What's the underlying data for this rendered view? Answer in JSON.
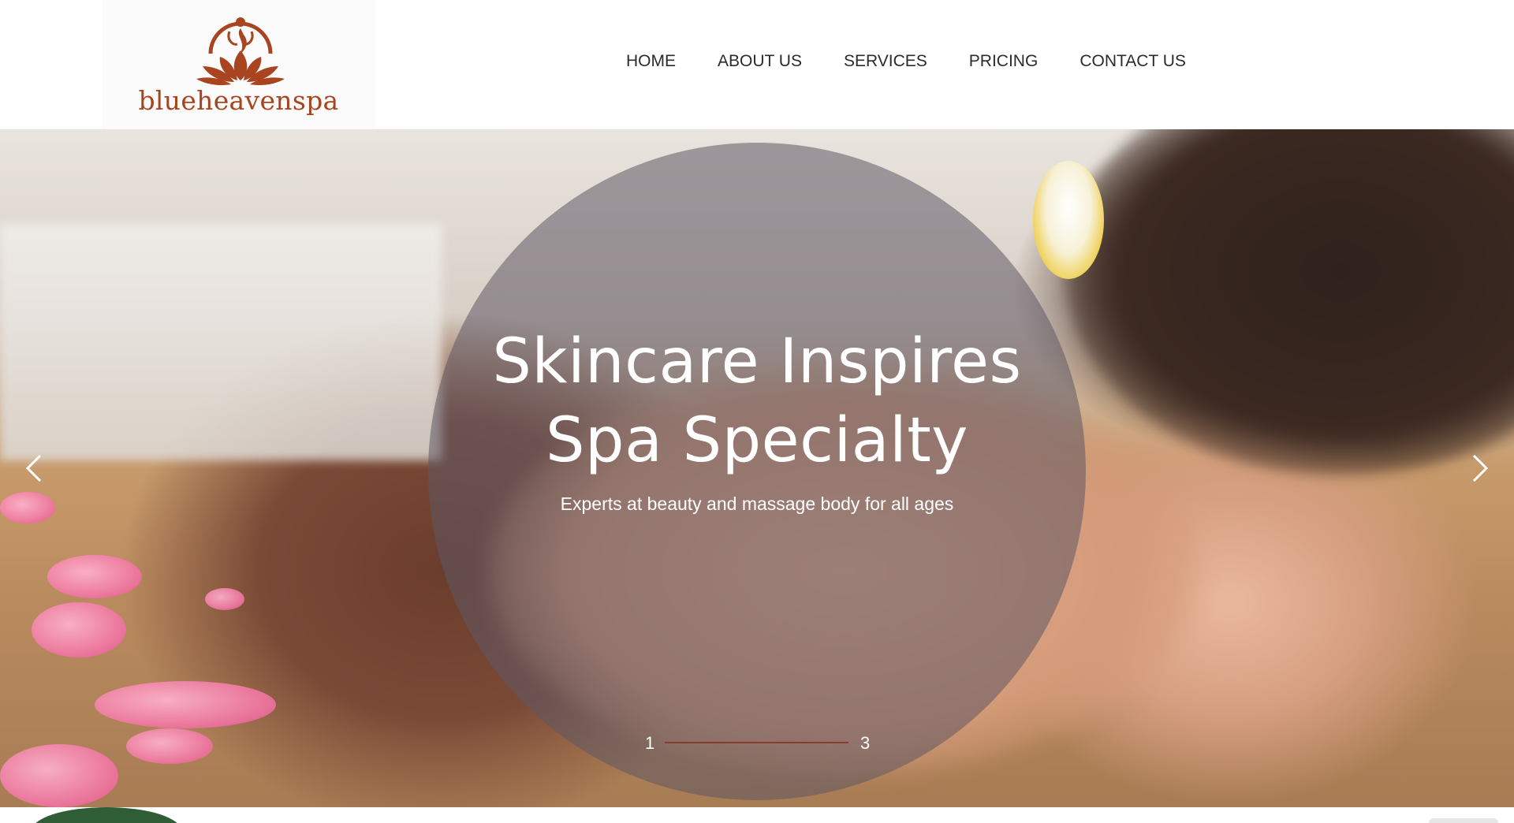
{
  "brand": {
    "name": "blueheavenspa",
    "logo_icon": "lotus-meditation-icon",
    "color": "#a8441f"
  },
  "nav": {
    "items": [
      {
        "label": "HOME"
      },
      {
        "label": "ABOUT US"
      },
      {
        "label": "SERVICES"
      },
      {
        "label": "PRICING"
      },
      {
        "label": "CONTACT US"
      }
    ]
  },
  "hero": {
    "title_line1": "Skincare Inspires",
    "title_line2": "Spa Specialty",
    "subtitle": "Experts at beauty and massage body for all ages",
    "prev_icon": "chevron-left-icon",
    "next_icon": "chevron-right-icon",
    "pager": {
      "start": "1",
      "end": "3",
      "current": 1,
      "accent": "#8a3b2b"
    },
    "overlay_color": "#5f5864"
  }
}
